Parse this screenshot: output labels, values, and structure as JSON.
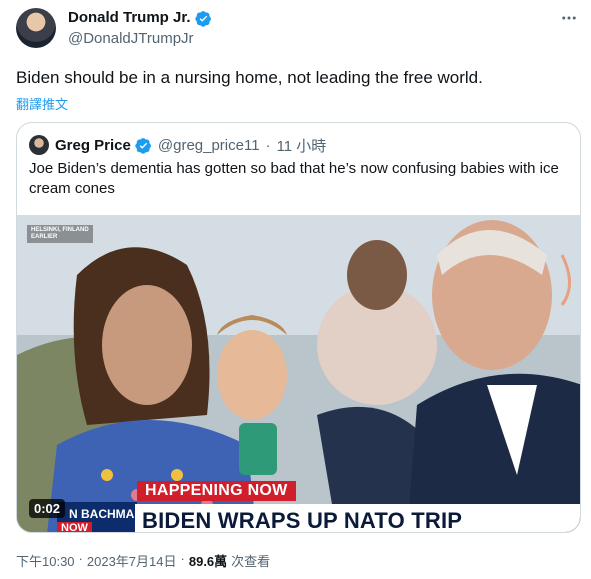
{
  "tweet": {
    "display_name": "Donald Trump Jr.",
    "handle": "@DonaldJTrumpJr",
    "text": "Biden should be in a nursing home, not leading the free world.",
    "translate_label": "翻譯推文"
  },
  "quote": {
    "display_name": "Greg Price",
    "handle": "@greg_price11",
    "separator": "·",
    "time": "11 小時",
    "text": "Joe Biden’s dementia has gotten so bad that he’s now confusing babies with ice cream cones"
  },
  "video": {
    "location_line1": "HELSINKI, FINLAND",
    "location_line2": "EARLIER",
    "banner": "HAPPENING NOW",
    "headline": "BIDEN WRAPS UP NATO TRIP",
    "reporter": "N BACHMAN",
    "reporter_tag": "NOW",
    "duration": "0:02"
  },
  "footer": {
    "time": "下午10:30",
    "dot1": "·",
    "date": "2023年7月14日",
    "dot2": "·",
    "views": "89.6萬",
    "views_label": "次查看"
  },
  "colors": {
    "accent": "#1d9bf0",
    "verified": "#1d9bf0",
    "news_red": "#d01e2a"
  },
  "icons": {
    "verified": "verified-badge-icon",
    "more": "more-dots-icon"
  }
}
